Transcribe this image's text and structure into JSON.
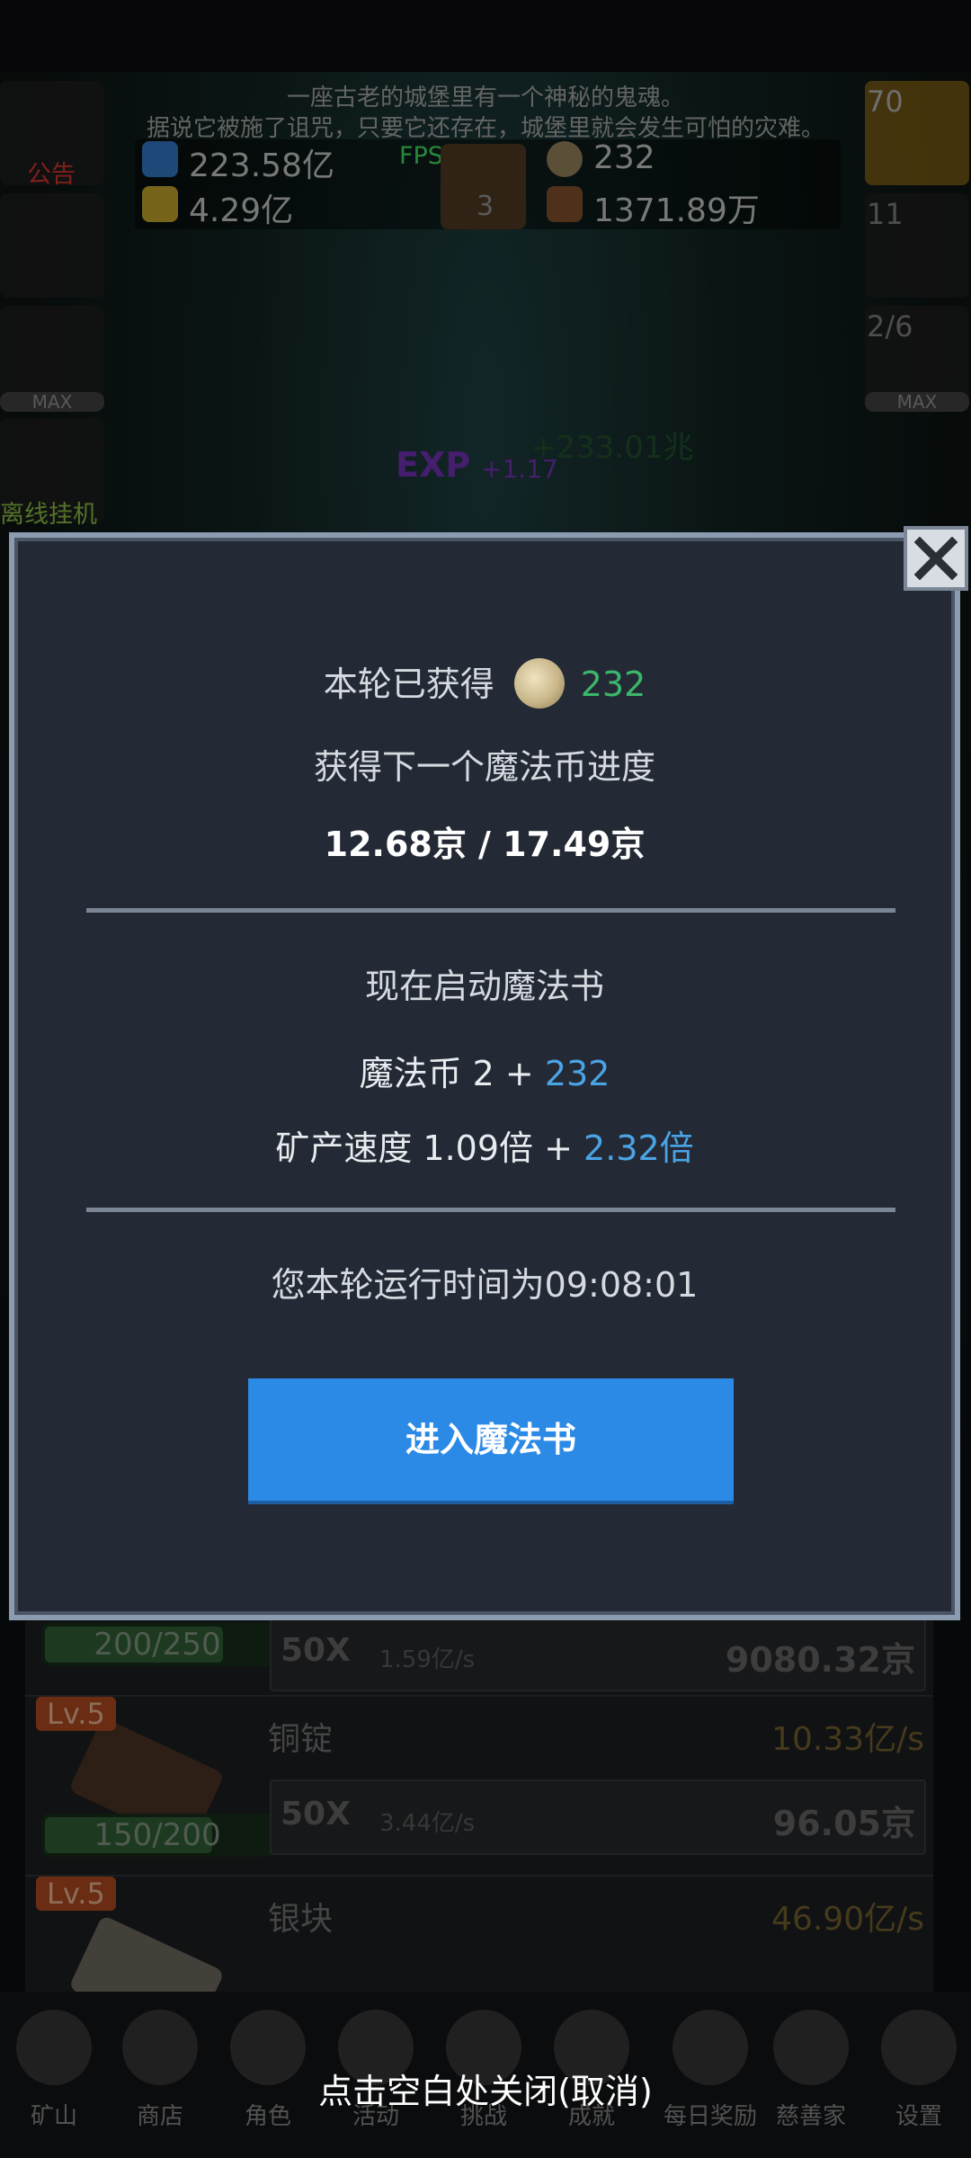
{
  "ticker": {
    "line1": "一座古老的城堡里有一个神秘的鬼魂。",
    "line2": "据说它被施了诅咒，只要它还存在，城堡里就会发生可怕的灾难。"
  },
  "fps": "FPS45",
  "resources": {
    "blue_potion": "223.58亿",
    "yellow_potion": "4.29亿",
    "magic_coin": "232",
    "meat": "1371.89万",
    "book_count": "3"
  },
  "side_left": {
    "notice_label": "公告",
    "offline_label": "离线挂机",
    "max_label": "MAX"
  },
  "side_right": {
    "potion_count": "70",
    "chest_count": "11",
    "slime_progress": "2/6",
    "max_label": "MAX"
  },
  "floating": {
    "exp_label": "EXP",
    "exp_plus": "+1.17",
    "gain_text": "+233.01兆"
  },
  "modal": {
    "gain_prefix": "本轮已获得",
    "gain_value": "232",
    "progress_title": "获得下一个魔法币进度",
    "progress_value": "12.68京 / 17.49京",
    "start_title": "现在启动魔法书",
    "coin_line_prefix": "魔法币 2 + ",
    "coin_line_bonus": "232",
    "speed_line_prefix": "矿产速度 1.09倍 + ",
    "speed_line_bonus": "2.32倍",
    "runtime": "您本轮运行时间为09:08:01",
    "enter_button": "进入魔法书"
  },
  "list": {
    "row1": {
      "progress": "200/250",
      "progress_fraction": 0.8,
      "multiplier": "50X",
      "per_sec": "1.59亿/s",
      "cost": "9080.32京"
    },
    "row2": {
      "level": "Lv.5",
      "name": "铜锭",
      "rate": "10.33亿/s",
      "progress": "150/200",
      "progress_fraction": 0.75,
      "multiplier": "50X",
      "per_sec": "3.44亿/s",
      "cost": "96.05京"
    },
    "row3": {
      "level": "Lv.5",
      "name": "银块",
      "rate": "46.90亿/s"
    }
  },
  "nav": [
    {
      "label": "矿山",
      "icon": "lantern-icon"
    },
    {
      "label": "商店",
      "icon": "ore-icon"
    },
    {
      "label": "角色",
      "icon": "skull-icon"
    },
    {
      "label": "活动",
      "icon": "scroll-icon"
    },
    {
      "label": "挑战",
      "icon": "map-icon"
    },
    {
      "label": "成就",
      "icon": "key-icon"
    },
    {
      "label": "每日奖励",
      "icon": "letter-icon"
    },
    {
      "label": "慈善家",
      "icon": "bread-icon"
    },
    {
      "label": "设置",
      "icon": "gear-icon"
    }
  ],
  "dismiss_hint": "点击空白处关闭(取消)",
  "colors": {
    "modal_bg": "#242a35",
    "accent_blue": "#2b8ae6",
    "green": "#3bb66a",
    "bonus_blue": "#4aa4e6"
  }
}
